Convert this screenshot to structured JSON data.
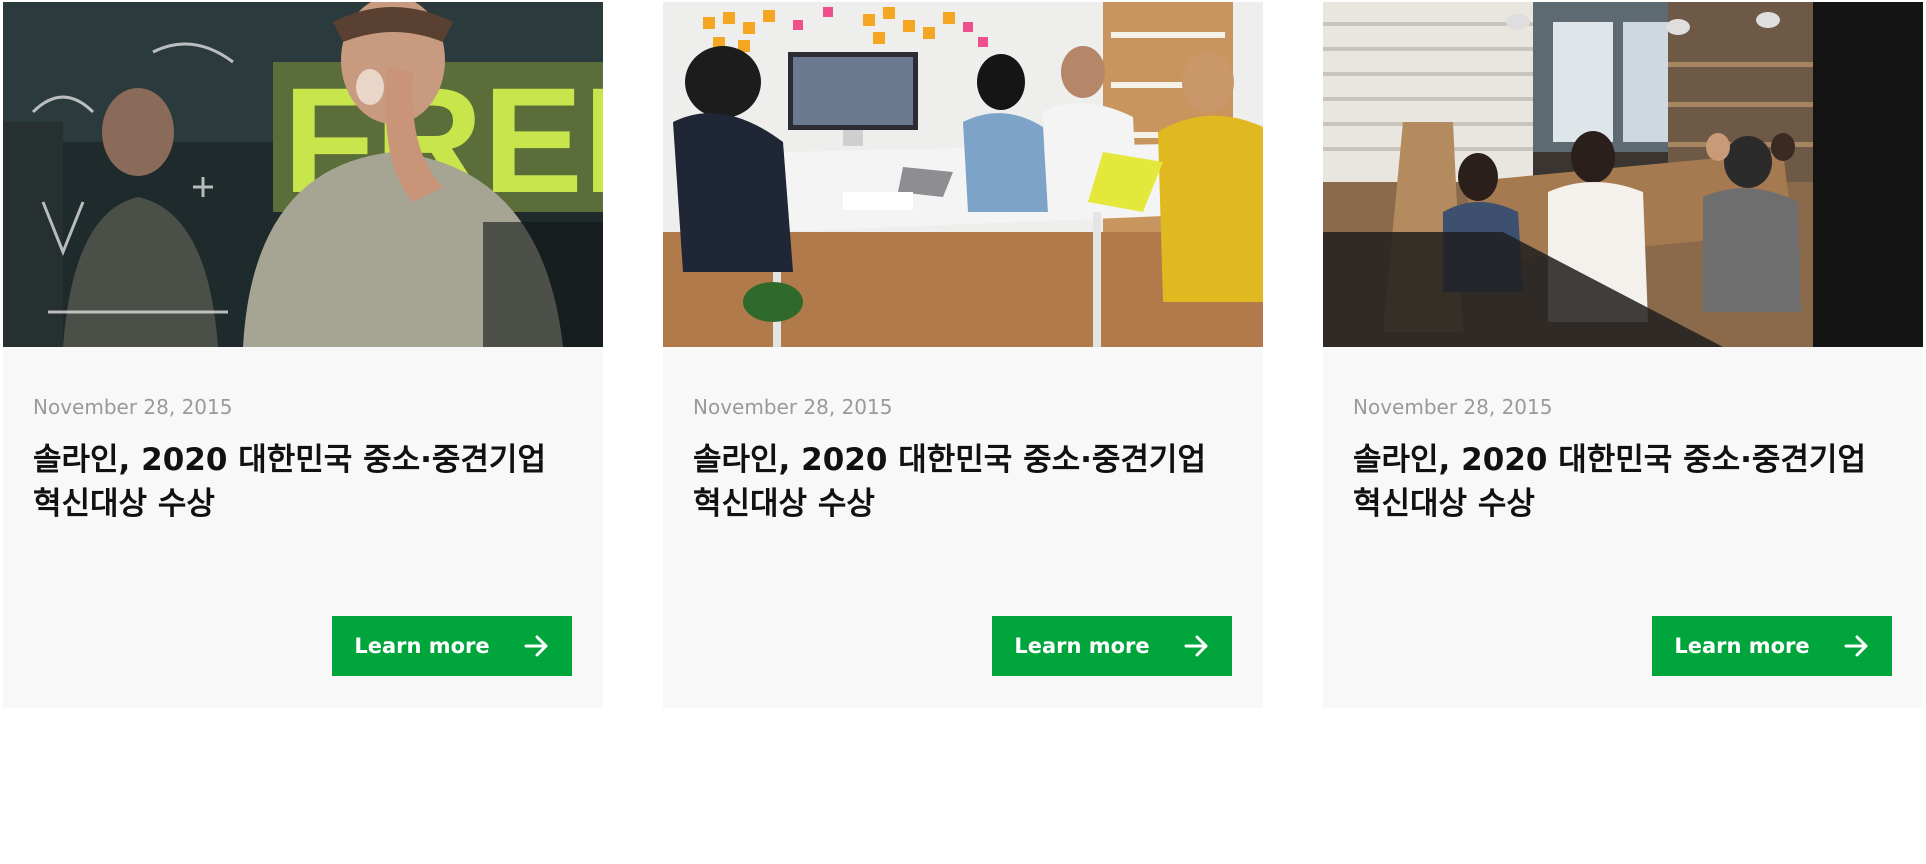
{
  "accent_color": "#00a63c",
  "cards": [
    {
      "image": "whiteboard-marketing-photo",
      "date": "November 28, 2015",
      "title": "솔라인, 2020 대한민국 중소·중견기업 혁신대상 수상",
      "button_label": "Learn more",
      "button_icon": "arrow-right-icon"
    },
    {
      "image": "team-meeting-photo",
      "date": "November 28, 2015",
      "title": "솔라인, 2020 대한민국 중소·중견기업 혁신대상 수상",
      "button_label": "Learn more",
      "button_icon": "arrow-right-icon"
    },
    {
      "image": "office-table-photo",
      "date": "November 28, 2015",
      "title": "솔라인, 2020 대한민국 중소·중견기업 혁신대상 수상",
      "button_label": "Learn more",
      "button_icon": "arrow-right-icon"
    }
  ]
}
